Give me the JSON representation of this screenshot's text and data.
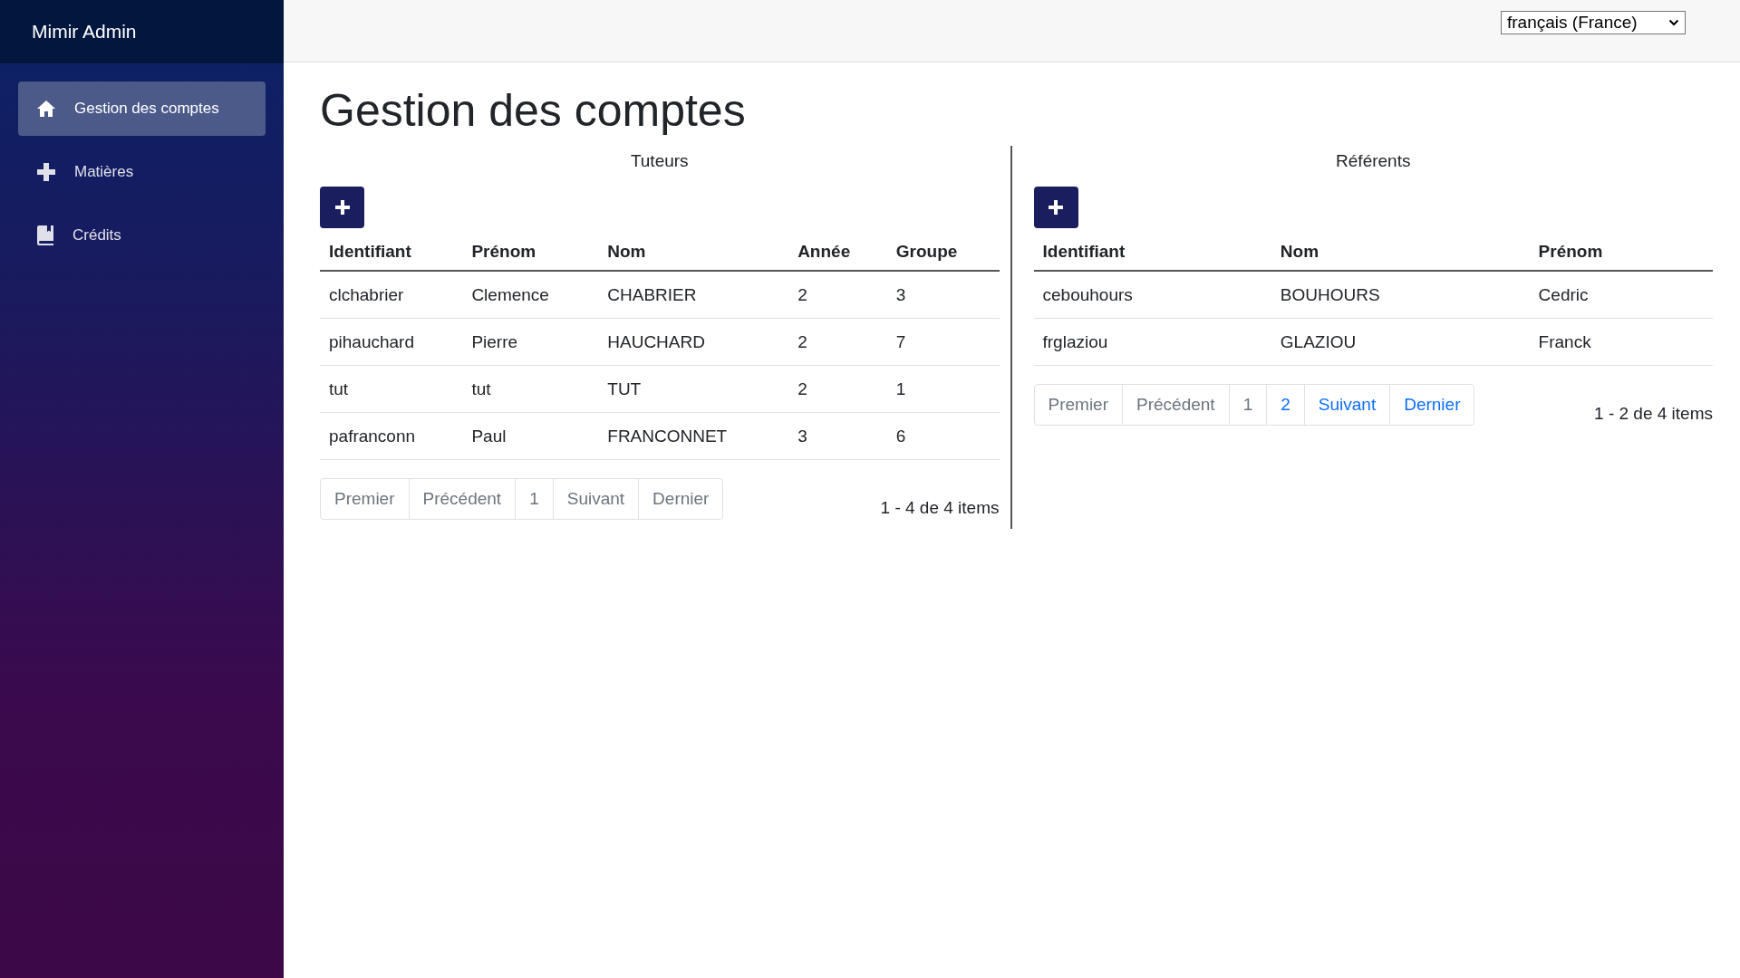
{
  "sidebar": {
    "brand": "Mimir Admin",
    "items": [
      {
        "label": "Gestion des comptes",
        "selected": true
      },
      {
        "label": "Matières",
        "selected": false
      },
      {
        "label": "Crédits",
        "selected": false
      }
    ]
  },
  "language_select": {
    "value": "français (France)"
  },
  "page_title": "Gestion des comptes",
  "panels": [
    {
      "title": "Tuteurs",
      "columns": [
        "Identifiant",
        "Prénom",
        "Nom",
        "Année",
        "Groupe"
      ],
      "rows": [
        [
          "clchabrier",
          "Clemence",
          "CHABRIER",
          "2",
          "3"
        ],
        [
          "pihauchard",
          "Pierre",
          "HAUCHARD",
          "2",
          "7"
        ],
        [
          "tut",
          "tut",
          "TUT",
          "2",
          "1"
        ],
        [
          "pafranconn",
          "Paul",
          "FRANCONNET",
          "3",
          "6"
        ]
      ],
      "pager": [
        {
          "label": "Premier",
          "disabled": true
        },
        {
          "label": "Précédent",
          "disabled": true
        },
        {
          "label": "1",
          "disabled": true
        },
        {
          "label": "Suivant",
          "disabled": true
        },
        {
          "label": "Dernier",
          "disabled": true
        }
      ],
      "summary": "1 - 4 de 4 items"
    },
    {
      "title": "Référents",
      "columns": [
        "Identifiant",
        "Nom",
        "Prénom"
      ],
      "rows": [
        [
          "cebouhours",
          "BOUHOURS",
          "Cedric"
        ],
        [
          "frglaziou",
          "GLAZIOU",
          "Franck"
        ]
      ],
      "pager": [
        {
          "label": "Premier",
          "disabled": true
        },
        {
          "label": "Précédent",
          "disabled": true
        },
        {
          "label": "1",
          "disabled": true
        },
        {
          "label": "2",
          "disabled": false
        },
        {
          "label": "Suivant",
          "disabled": false
        },
        {
          "label": "Dernier",
          "disabled": false
        }
      ],
      "summary": "1 - 2 de 4 items"
    }
  ]
}
